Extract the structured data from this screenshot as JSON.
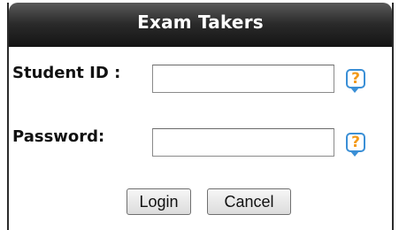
{
  "header": {
    "title": "Exam Takers"
  },
  "fields": {
    "student_id": {
      "label": "Student ID :",
      "value": "",
      "help_icon": "question-mark"
    },
    "password": {
      "label": "Password:",
      "value": "",
      "help_icon": "question-mark"
    }
  },
  "help": {
    "glyph": "?"
  },
  "buttons": {
    "login": "Login",
    "cancel": "Cancel"
  },
  "colors": {
    "header_dark": "#1a1a1a",
    "help_border": "#3a8fd6",
    "help_glyph": "#f39a1a"
  }
}
